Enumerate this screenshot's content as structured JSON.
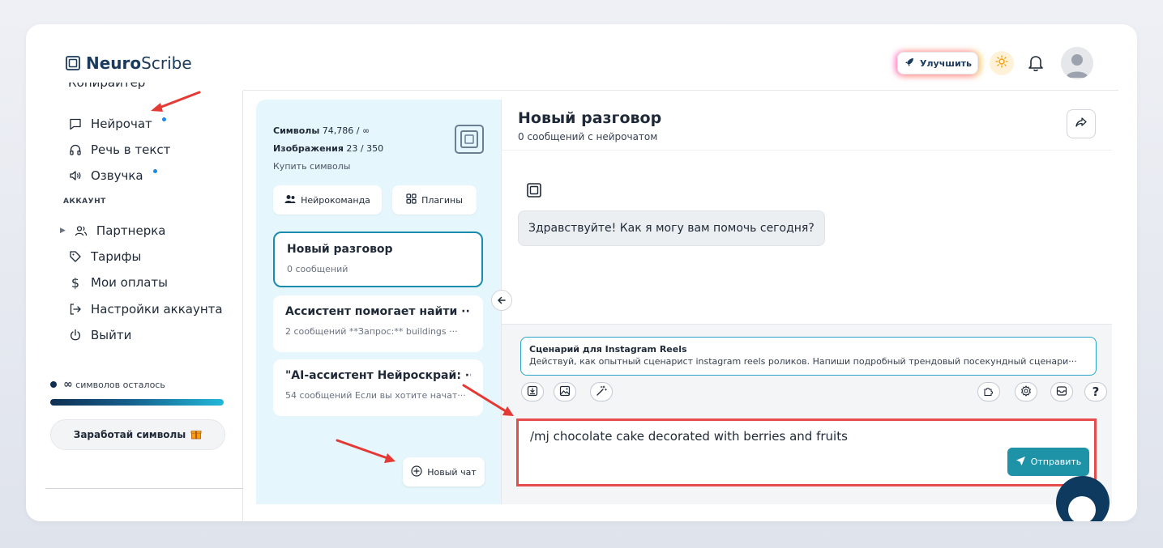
{
  "app": {
    "name_bold": "Neuro",
    "name_rest": "Scribe"
  },
  "header": {
    "upgrade_label": "Улучшить"
  },
  "sidebar": {
    "cut_off_item": "Копирайтер",
    "items": [
      {
        "label": "Нейрочат",
        "icon": "chat-icon",
        "dot": true
      },
      {
        "label": "Речь в текст",
        "icon": "headphones-icon",
        "dot": false
      },
      {
        "label": "Озвучка",
        "icon": "speaker-icon",
        "dot": true
      }
    ],
    "account_label": "АККАУНТ",
    "account_items": [
      {
        "label": "Партнерка",
        "icon": "users-icon"
      },
      {
        "label": "Тарифы",
        "icon": "tag-icon"
      },
      {
        "label": "Мои оплаты",
        "icon": "dollar-icon"
      },
      {
        "label": "Настройки аккаунта",
        "icon": "login-icon"
      },
      {
        "label": "Выйти",
        "icon": "power-icon"
      }
    ],
    "symbols_left": "символов осталось",
    "symbols_left_value": "∞",
    "earn_label": "Заработай символы"
  },
  "stats": {
    "symbols_label": "Символы",
    "symbols_value": "74,786 / ∞",
    "images_label": "Изображения",
    "images_value": "23 / 350",
    "buy_label": "Купить символы"
  },
  "chatlist": {
    "team_label": "Нейрокоманда",
    "plugins_label": "Плагины",
    "chats": [
      {
        "title": "Новый разговор",
        "subtitle": "0 сообщений"
      },
      {
        "title": "Ассистент помогает найти ···",
        "subtitle": "2 сообщений   **Запрос:** buildings ···"
      },
      {
        "title": "\"AI-ассистент Нейроскрай: ···",
        "subtitle": "54 сообщений  Если вы хотите начат···"
      }
    ],
    "new_chat_label": "Новый чат"
  },
  "conversation": {
    "title": "Новый разговор",
    "subtitle": "0 сообщений с нейрочатом",
    "greeting": "Здравствуйте! Как я могу вам помочь сегодня?"
  },
  "composer": {
    "prompt_title": "Сценарий для Instagram Reels",
    "prompt_desc": "Действуй, как опытный сценарист instagram reels роликов. Напиши подробный трендовый посекундный сценари···",
    "input_value": "/mj chocolate cake decorated with berries and fruits",
    "send_label": "Отправить",
    "help_label": "?"
  },
  "colors": {
    "accent": "#1e93a8",
    "brand_dark": "#0f2f52",
    "highlight_red": "#e74c4c",
    "chatlist_bg": "#e6f6fd"
  }
}
